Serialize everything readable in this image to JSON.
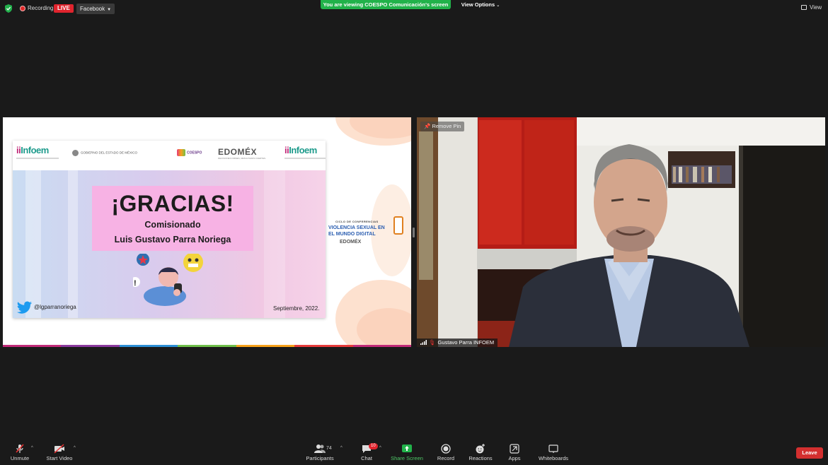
{
  "topbar": {
    "recording_label": "Recording",
    "live_label": "LIVE",
    "stream_target": "Facebook",
    "viewing_banner": "You are viewing COESPO Comunicación's screen",
    "view_options_label": "View Options",
    "view_label": "View"
  },
  "shared_slide": {
    "title": "¡GRACIAS!",
    "subtitle": "Comisionado",
    "person_name": "Luis Gustavo Parra Noriega",
    "twitter_handle": "@lgparranoriega",
    "date": "Septiembre, 2022.",
    "logos": {
      "infoem_left": "Infoem",
      "infoem_right": "Infoem",
      "gobierno": "GOBIERNO DEL ESTADO DE MÉXICO",
      "coespo": "COESPO",
      "edomex": "EDOMÉX",
      "edomex_sub": "DECISIONES FIRMES, RESULTADOS FUERTES."
    },
    "side_banner": {
      "line_small": "CICLO DE CONFERENCIAS",
      "line1": "VIOLENCIA SEXUAL EN",
      "line2": "EL MUNDO DIGITAL",
      "logo": "EDOMÉX"
    }
  },
  "video_tile": {
    "remove_pin_label": "Remove Pin",
    "participant_name": "Gustavo Parra INFOEM"
  },
  "toolbar": {
    "unmute": "Unmute",
    "start_video": "Start Video",
    "participants": "Participants",
    "participants_count": "74",
    "chat": "Chat",
    "chat_badge": "10",
    "share_screen": "Share Screen",
    "record": "Record",
    "reactions": "Reactions",
    "apps": "Apps",
    "whiteboards": "Whiteboards",
    "leave": "Leave"
  },
  "colors": {
    "live_red": "#e0242d",
    "banner_green": "#21b24a",
    "share_green": "#4fc767",
    "leave_red": "#d32f2f",
    "slide_pink": "#f7b2e4"
  }
}
